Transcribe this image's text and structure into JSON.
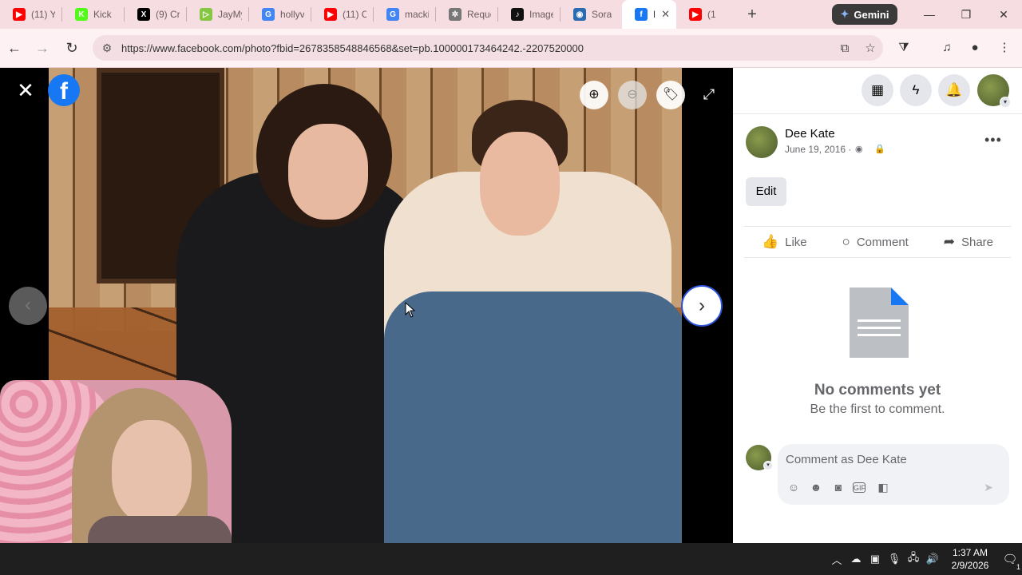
{
  "browser": {
    "tabs": [
      {
        "title": "(11) Y",
        "favicon": "youtube-icon",
        "color": "#ff0000",
        "glyph": "▶"
      },
      {
        "title": "Kick",
        "favicon": "kick-icon",
        "color": "#53fc18",
        "glyph": "K"
      },
      {
        "title": "(9) Cr",
        "favicon": "x-icon",
        "color": "#000000",
        "glyph": "X"
      },
      {
        "title": "JayMy",
        "favicon": "rumble-icon",
        "color": "#85c742",
        "glyph": "▷"
      },
      {
        "title": "hollyv",
        "favicon": "google-icon",
        "color": "#4285f4",
        "glyph": "G"
      },
      {
        "title": "(11) C",
        "favicon": "youtube-icon",
        "color": "#ff0000",
        "glyph": "▶"
      },
      {
        "title": "macki",
        "favicon": "google-icon",
        "color": "#4285f4",
        "glyph": "G"
      },
      {
        "title": "Reque",
        "favicon": "openai-icon",
        "color": "#777777",
        "glyph": "✲"
      },
      {
        "title": "Image",
        "favicon": "tiktok-icon",
        "color": "#111111",
        "glyph": "♪"
      },
      {
        "title": "Sora",
        "favicon": "sora-icon",
        "color": "#2b6cb0",
        "glyph": "◉"
      },
      {
        "title": "F",
        "favicon": "facebook-icon",
        "color": "#1877f2",
        "glyph": "f",
        "active": true
      },
      {
        "title": "(1",
        "favicon": "youtube-icon",
        "color": "#ff0000",
        "glyph": "▶"
      }
    ],
    "new_tab_label": "+",
    "gemini_label": "Gemini",
    "url": "https://www.facebook.com/photo?fbid=2678358548846568&set=pb.100000173464242.-2207520000"
  },
  "viewer": {
    "close_glyph": "✕",
    "fb_logo": "f",
    "zoom_in_glyph": "⊕",
    "zoom_out_glyph": "⊖",
    "tag_glyph": "🏷",
    "fullscreen_glyph": "⤢",
    "prev_glyph": "‹",
    "next_glyph": "›"
  },
  "panel": {
    "author": "Dee Kate",
    "date": "June 19, 2016",
    "dot": "·",
    "globe_glyph": "◉",
    "lock_glyph": "🔒",
    "more_glyph": "•••",
    "edit_label": "Edit",
    "actions": {
      "like": "Like",
      "comment": "Comment",
      "share": "Share"
    },
    "no_comments_title": "No comments yet",
    "no_comments_sub": "Be the first to comment.",
    "comment_placeholder": "Comment as Dee Kate"
  },
  "taskbar": {
    "time": "1:37 AM",
    "date": "2/9/2026",
    "notif_count": "1"
  }
}
